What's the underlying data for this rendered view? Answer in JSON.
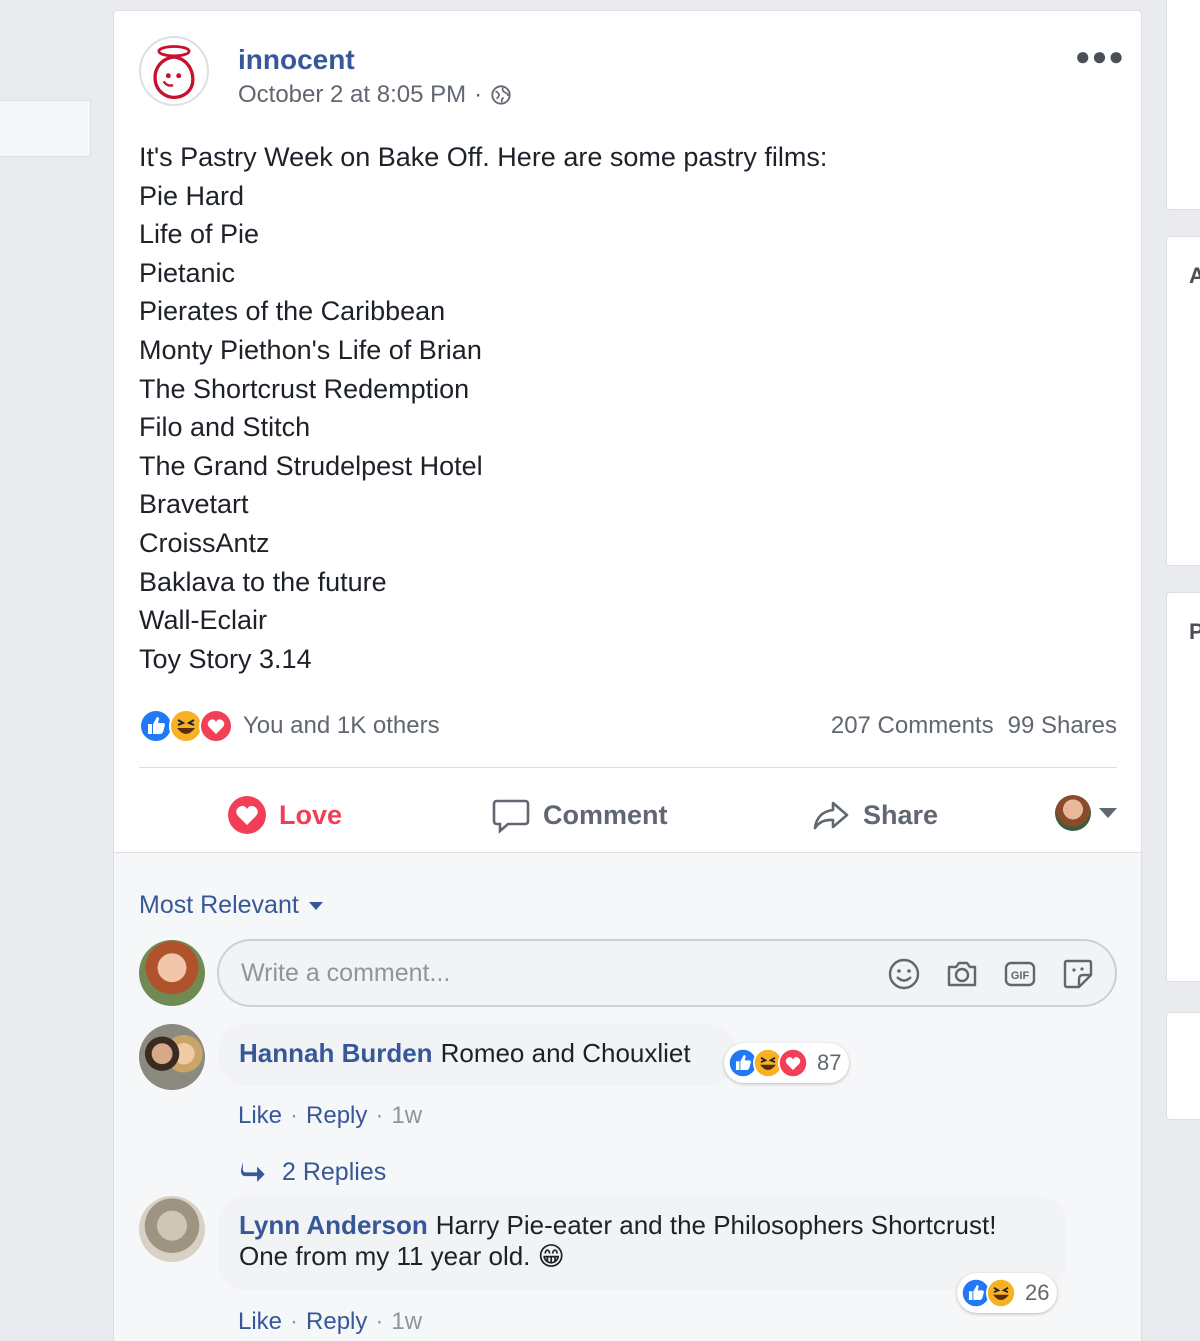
{
  "post": {
    "page_name": "innocent",
    "timestamp": "October 2 at 8:05 PM",
    "separator": "·",
    "lines": [
      "It's Pastry Week on Bake Off. Here are some pastry films:",
      "Pie Hard",
      "Life of Pie",
      "Pietanic",
      "Pierates of the Caribbean",
      "Monty Piethon's Life of Brian",
      "The Shortcrust Redemption",
      "Filo and Stitch",
      "The Grand Strudelpest Hotel",
      "Bravetart",
      "CroissAntz",
      "Baklava to the future",
      "Wall-Eclair",
      "Toy Story 3.14"
    ],
    "reactions_summary": "You and 1K others",
    "comments_count": "207 Comments",
    "shares_count": "99 Shares",
    "reaction_icons": [
      "like-icon",
      "haha-icon",
      "love-icon"
    ]
  },
  "actions": {
    "love": "Love",
    "comment": "Comment",
    "share": "Share"
  },
  "comments_section": {
    "sort_label": "Most Relevant",
    "input_placeholder": "Write a comment...",
    "input_icons": [
      "emoji-icon",
      "camera-icon",
      "gif-icon",
      "sticker-icon"
    ],
    "comments": [
      {
        "author": "Hannah Burden",
        "text": "Romeo and Chouxliet",
        "reaction_count": "87",
        "like": "Like",
        "reply": "Reply",
        "age": "1w",
        "replies": "2 Replies"
      },
      {
        "author": "Lynn Anderson",
        "text": "Harry Pie-eater and the Philosophers Shortcrust! One from my 11 year old. 😁",
        "reaction_count": "26",
        "like": "Like",
        "reply": "Reply",
        "age": "1w"
      }
    ]
  },
  "colors": {
    "brand_link": "#365899",
    "love": "#f33e58",
    "like_blue": "#2078f4",
    "haha_yellow": "#f7b125",
    "background": "#e9ebee"
  }
}
